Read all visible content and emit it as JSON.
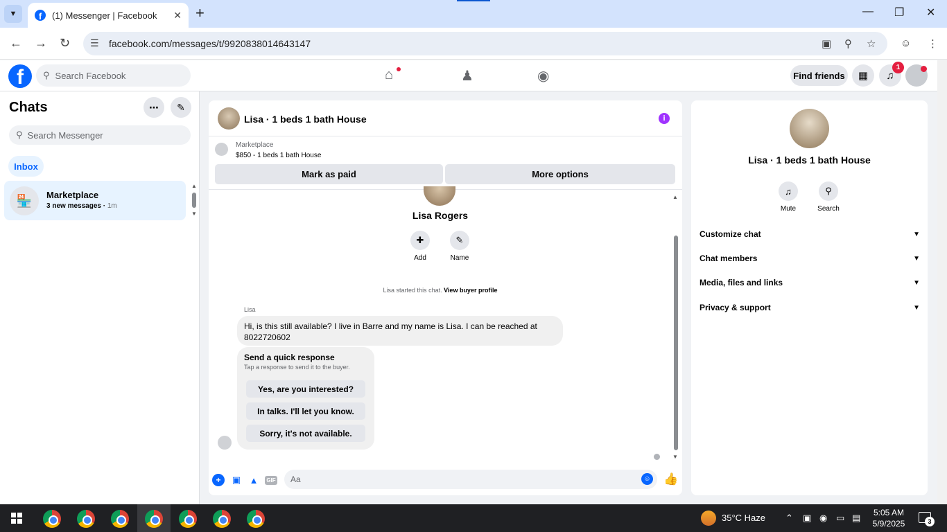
{
  "browser": {
    "tab_title": "(1) Messenger | Facebook",
    "url": "facebook.com/messages/t/9920838014643147"
  },
  "fb_header": {
    "search_placeholder": "Search Facebook",
    "find_friends": "Find friends",
    "notification_count": "1"
  },
  "sidebar": {
    "title": "Chats",
    "search_placeholder": "Search Messenger",
    "filter": "Inbox",
    "chats": [
      {
        "name": "Marketplace",
        "preview": "3 new messages",
        "time": "1m"
      }
    ]
  },
  "conversation": {
    "title": "Lisa · 1 beds 1 bath House",
    "marketplace_label": "Marketplace",
    "listing": "$850 - 1 beds 1 bath House",
    "mark_paid": "Mark as paid",
    "more_options": "More options",
    "contact_name": "Lisa Rogers",
    "actions": [
      {
        "label": "Add",
        "icon": "add-person-icon"
      },
      {
        "label": "Name",
        "icon": "pencil-icon"
      }
    ],
    "started_text": "Lisa started this chat.",
    "view_profile": "View buyer profile",
    "sender": "Lisa",
    "message": "Hi, is this still available? I live in Barre and my name is Lisa.  I can be reached at 8022720602",
    "quick_title": "Send a quick response",
    "quick_sub": "Tap a response to send it to the buyer.",
    "quick_options": [
      "Yes, are you interested?",
      "In talks. I'll let you know.",
      "Sorry, it's not available."
    ],
    "composer_placeholder": "Aa"
  },
  "right_panel": {
    "name": "Lisa · 1 beds 1 bath House",
    "actions": [
      {
        "label": "Mute",
        "icon": "bell-icon"
      },
      {
        "label": "Search",
        "icon": "search-icon"
      }
    ],
    "sections": [
      "Customize chat",
      "Chat members",
      "Media, files and links",
      "Privacy & support"
    ]
  },
  "taskbar": {
    "weather": "35°C  Haze",
    "time": "5:05 AM",
    "date": "5/9/2025",
    "notifications": "3"
  },
  "colors": {
    "accent": "#0866ff",
    "badge": "#e41e3f",
    "info": "#a033ff"
  }
}
